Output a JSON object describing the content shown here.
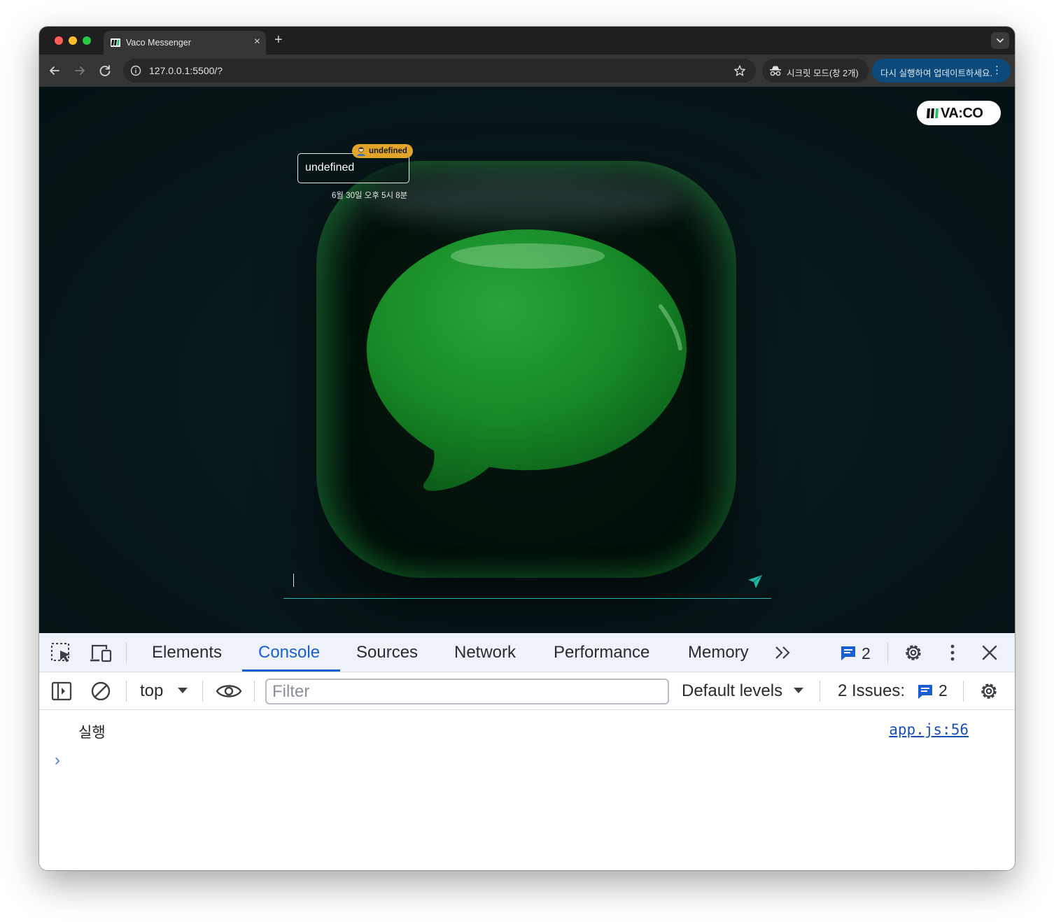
{
  "browser": {
    "tab_title": "Vaco Messenger",
    "tab_close": "×",
    "new_tab": "+",
    "url": "127.0.0.1:5500/?",
    "incognito_label": "시크릿 모드(창 2개)",
    "update_label": "다시 실행하여 업데이트하세요.",
    "update_menu": "⋮"
  },
  "page": {
    "logo_text": "VA:CO",
    "message": {
      "sender": "undefined",
      "text": "undefined",
      "time": "6월 30일 오후 5시 8분"
    },
    "input_value": ""
  },
  "devtools": {
    "tabs": [
      "Elements",
      "Console",
      "Sources",
      "Network",
      "Performance",
      "Memory"
    ],
    "active_tab": "Console",
    "more_tabs": "»",
    "messages_count": "2",
    "context": "top",
    "filter_placeholder": "Filter",
    "levels": "Default levels",
    "issues_label": "2 Issues:",
    "issues_count": "2",
    "console": {
      "log_text": "실행",
      "log_source": "app.js:56",
      "prompt": "›"
    }
  },
  "colors": {
    "accent": "#1a5fd1",
    "badge": "#e2a528",
    "input_underline": "#2bb5a9",
    "send_icon": "#22b3a3",
    "bubble_green": "#1a8a2a"
  }
}
